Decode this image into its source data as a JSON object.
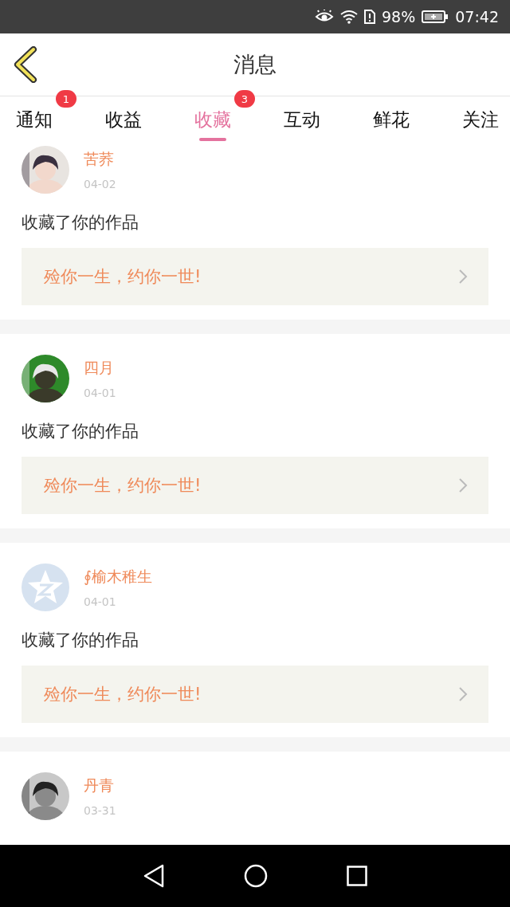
{
  "status_bar": {
    "battery": "98%",
    "time": "07:42"
  },
  "header": {
    "title": "消息"
  },
  "tabs": [
    {
      "label": "通知",
      "selected": false,
      "badge": "1"
    },
    {
      "label": "收益",
      "selected": false
    },
    {
      "label": "收藏",
      "selected": true,
      "badge": "3"
    },
    {
      "label": "互动",
      "selected": false
    },
    {
      "label": "鲜花",
      "selected": false
    },
    {
      "label": "关注",
      "selected": false
    }
  ],
  "messages": [
    {
      "name": "苦荞",
      "date": "04-02",
      "kind": "picture",
      "text": "收藏了你的作品",
      "work": "殓你一生，约你一世!"
    },
    {
      "name": "四月",
      "date": "04-01",
      "kind": "picture",
      "text": "收藏了你的作品",
      "work": "殓你一生，约你一世!"
    },
    {
      "name": "∮榆木稚生",
      "date": "04-01",
      "kind": "icon",
      "text": "收藏了你的作品",
      "work": "殓你一生，约你一世!"
    },
    {
      "name": "丹青",
      "date": "03-31",
      "kind": "picture"
    }
  ]
}
